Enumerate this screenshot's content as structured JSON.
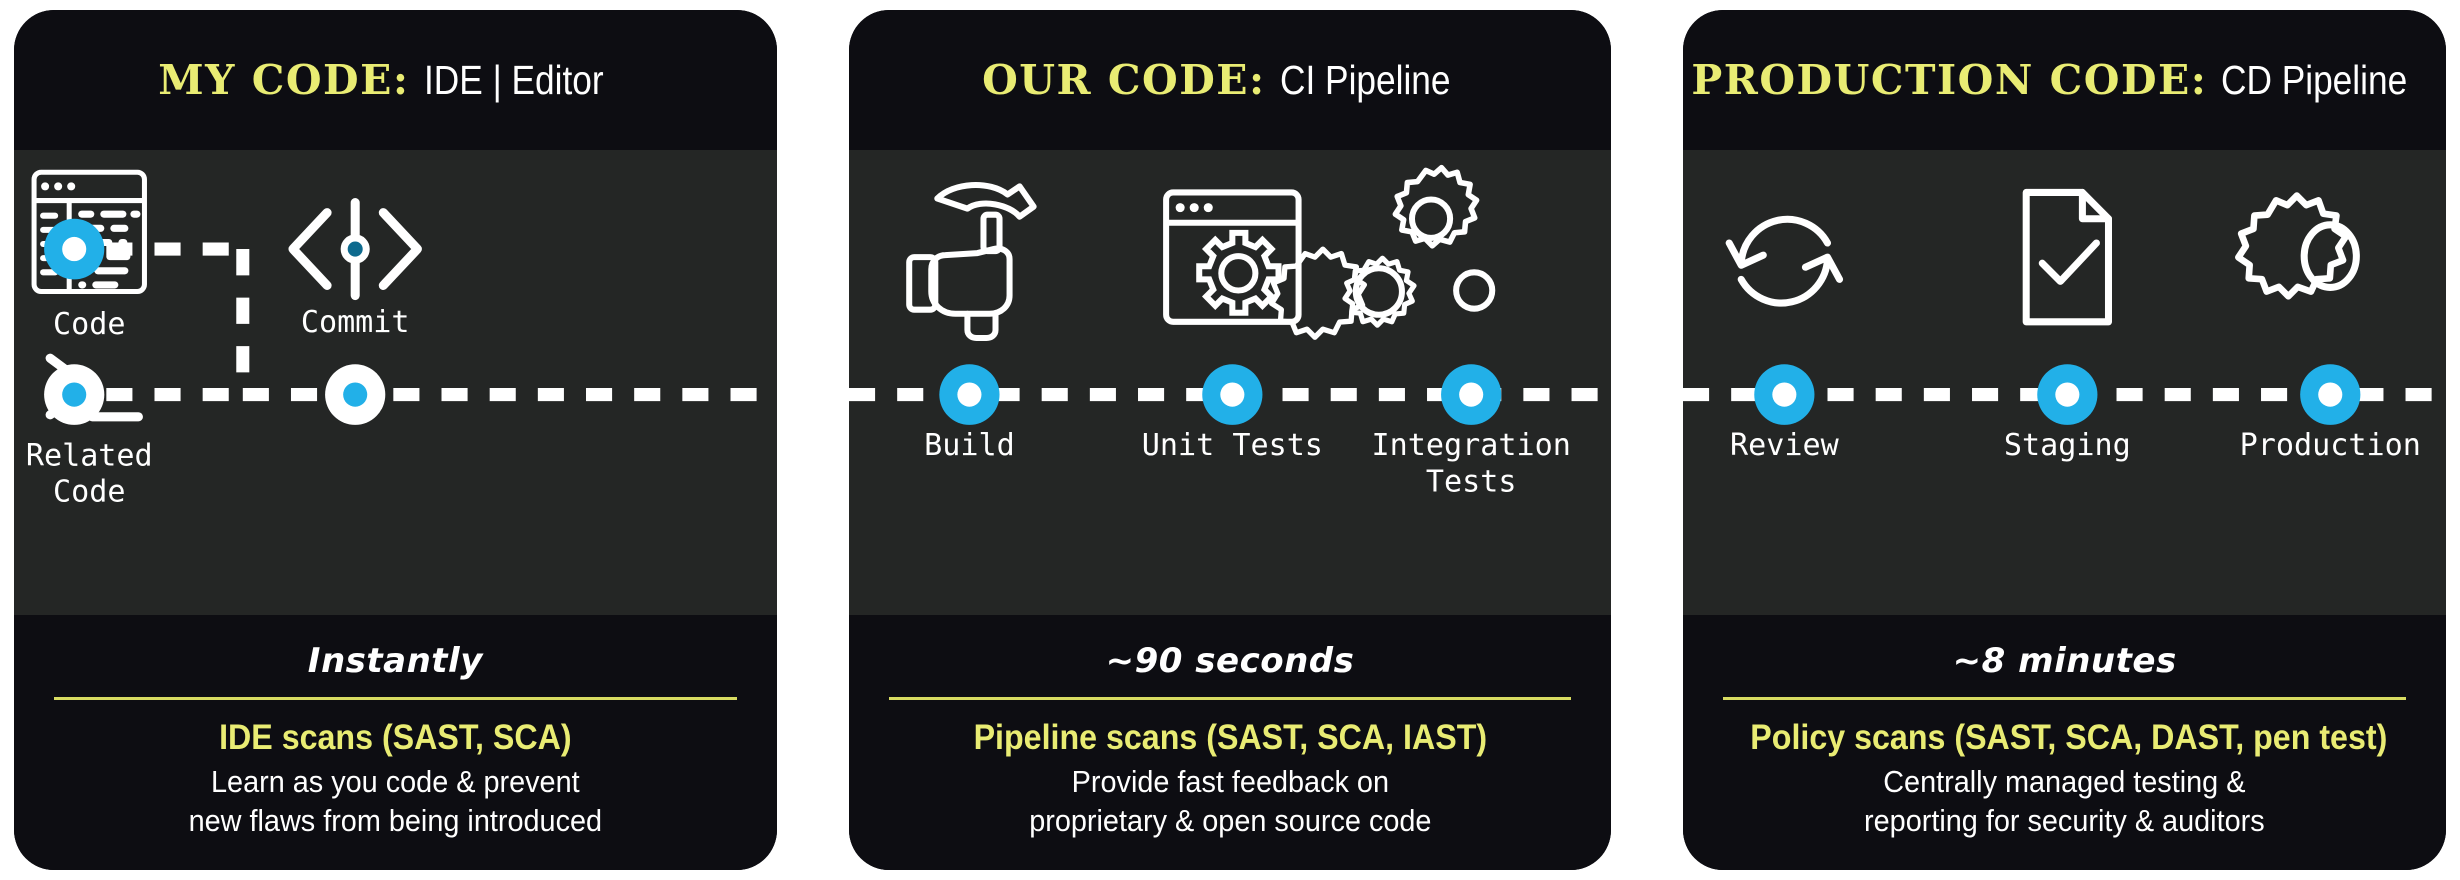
{
  "colors": {
    "page_background": "#ffffff",
    "card_dark": "#0d0d12",
    "stage_grey": "#242625",
    "accent_yellow": "#e9ec73",
    "rule_yellow": "#d8dc62",
    "node_blue": "#22b0e8",
    "line_white": "#ffffff"
  },
  "cards": [
    {
      "id": "my-code",
      "header": {
        "key": "MY CODE:",
        "value": "IDE | Editor"
      },
      "nodes": [
        {
          "label": "Code",
          "icon": "code-window-icon",
          "node_style": "blue-fill-white-center"
        },
        {
          "label": "Related\nCode",
          "icon": "terminal-prompt-icon",
          "node_style": "white-fill-blue-center"
        },
        {
          "label": "Commit",
          "icon": "commit-brackets-icon",
          "node_style": "white-fill-blue-center"
        }
      ],
      "node_labels": {
        "code": "Code",
        "related_1": "Related",
        "related_2": "Code",
        "commit": "Commit"
      },
      "footer": {
        "duration": "Instantly",
        "scan_title": "IDE scans (SAST, SCA)",
        "desc_line1": "Learn as you code & prevent",
        "desc_line2": "new flaws from being introduced"
      }
    },
    {
      "id": "our-code",
      "header": {
        "key": "OUR CODE:",
        "value": "CI Pipeline"
      },
      "nodes": [
        {
          "label": "Build",
          "icon": "hammer-hand-icon",
          "node_style": "blue-fill-white-center"
        },
        {
          "label": "Unit Tests",
          "icon": "window-gear-icon",
          "node_style": "blue-fill-white-center"
        },
        {
          "label": "Integration\nTests",
          "icon": "three-gears-icon",
          "node_style": "blue-fill-white-center"
        }
      ],
      "node_labels": {
        "build": "Build",
        "unit": "Unit Tests",
        "integration_1": "Integration",
        "integration_2": "Tests"
      },
      "footer": {
        "duration": "~90 seconds",
        "scan_title": "Pipeline scans (SAST, SCA, IAST)",
        "desc_line1": "Provide fast feedback on",
        "desc_line2": "proprietary & open source code"
      }
    },
    {
      "id": "production-code",
      "header": {
        "key": "PRODUCTION CODE:",
        "value": "CD Pipeline"
      },
      "nodes": [
        {
          "label": "Review",
          "icon": "sync-arrows-icon",
          "node_style": "blue-fill-white-center"
        },
        {
          "label": "Staging",
          "icon": "document-check-icon",
          "node_style": "blue-fill-white-center"
        },
        {
          "label": "Production",
          "icon": "gear-icon",
          "node_style": "blue-fill-white-center"
        }
      ],
      "node_labels": {
        "review": "Review",
        "staging": "Staging",
        "production": "Production"
      },
      "footer": {
        "duration": "~8 minutes",
        "scan_title": "Policy scans (SAST, SCA, DAST, pen test)",
        "desc_line1": "Centrally managed testing &",
        "desc_line2": "reporting for security & auditors"
      }
    }
  ]
}
